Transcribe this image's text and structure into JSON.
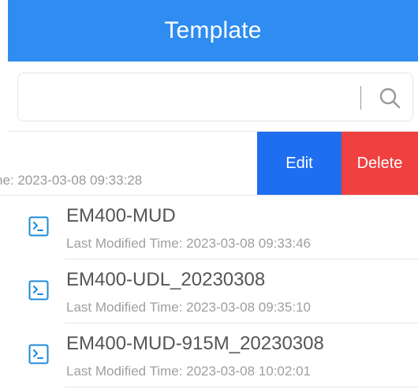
{
  "header": {
    "title": "Template"
  },
  "search": {
    "placeholder": "",
    "value": ""
  },
  "swiped_item": {
    "time_fragment": "ne: 2023-03-08 09:33:28",
    "edit_label": "Edit",
    "delete_label": "Delete"
  },
  "items": [
    {
      "name": "EM400-MUD",
      "time": "Last Modified Time: 2023-03-08 09:33:46"
    },
    {
      "name": "EM400-UDL_20230308",
      "time": "Last Modified Time: 2023-03-08 09:35:10"
    },
    {
      "name": "EM400-MUD-915M_20230308",
      "time": "Last Modified Time: 2023-03-08 10:02:01"
    }
  ],
  "colors": {
    "header": "#2f8cf0",
    "edit": "#1f6ef0",
    "delete": "#f04040",
    "icon": "#1f8ad8"
  },
  "icons": {
    "search": "search-icon",
    "template": "terminal-file-icon"
  }
}
